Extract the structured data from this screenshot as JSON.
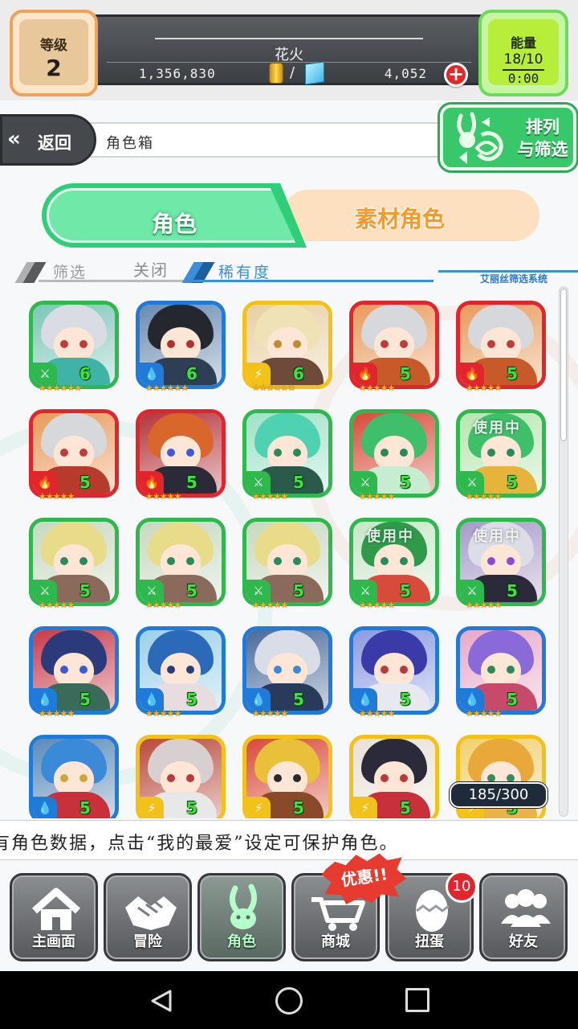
{
  "header": {
    "level_label": "等级",
    "level_value": "2",
    "player_name": "花火",
    "gold": "1,356,830",
    "gem_divider": "/",
    "gems": "4,052",
    "add_symbol": "+",
    "energy_label": "能量",
    "energy_value": "18/10",
    "energy_timer": "0:00"
  },
  "nav": {
    "back_chevron": "«",
    "back_label": "返回",
    "breadcrumb": "角色箱",
    "sort_label_line1": "排列",
    "sort_label_line2": "与筛选"
  },
  "tabs": [
    {
      "label": "角色",
      "active": true
    },
    {
      "label": "素材角色",
      "active": false
    }
  ],
  "filter": {
    "filter_label": "筛选",
    "filter_state": "关闭",
    "sort_by": "稀有度",
    "system_label": "艾丽丝筛选系统"
  },
  "colors": {
    "wood": "#2fb84e",
    "water": "#1f7ad8",
    "fire": "#e0262c",
    "light": "#f2c21a"
  },
  "cards": [
    {
      "element": "wood",
      "icon": "wood-element-icon",
      "glyph": "⚔",
      "rarity": "6",
      "stars": "★★★★★★",
      "in_use": "",
      "hair": "#d9dde3",
      "bg": "#7cc6b8",
      "body": "#3fb3a5",
      "eye": "#c23a3a"
    },
    {
      "element": "water",
      "icon": "water-element-icon",
      "glyph": "💧",
      "rarity": "6",
      "stars": "★★★★★★",
      "in_use": "",
      "hair": "#25272e",
      "bg": "#6a8ab0",
      "body": "#2e3f55",
      "eye": "#b23030"
    },
    {
      "element": "light",
      "icon": "light-element-icon",
      "glyph": "⚡",
      "rarity": "6",
      "stars": "★★★★★★",
      "in_use": "",
      "hair": "#efe2b6",
      "bg": "#e8cfa3",
      "body": "#6e4a3a",
      "eye": "#c28a2a"
    },
    {
      "element": "fire",
      "icon": "fire-element-icon",
      "glyph": "🔥",
      "rarity": "5",
      "stars": "★★★★★",
      "in_use": "",
      "hair": "#d6d8dc",
      "bg": "#e89a5a",
      "body": "#c85a2a",
      "eye": "#c23a3a"
    },
    {
      "element": "fire",
      "icon": "fire-element-icon",
      "glyph": "🔥",
      "rarity": "5",
      "stars": "★★★★★",
      "in_use": "",
      "hair": "#d6d8dc",
      "bg": "#e89a5a",
      "body": "#c85a2a",
      "eye": "#c23a3a"
    },
    {
      "element": "fire",
      "icon": "fire-element-icon",
      "glyph": "🔥",
      "rarity": "5",
      "stars": "★★★★★",
      "in_use": "",
      "hair": "#d6d8dc",
      "bg": "#e89a5a",
      "body": "#b83a2a",
      "eye": "#c23a3a"
    },
    {
      "element": "fire",
      "icon": "fire-element-icon",
      "glyph": "🔥",
      "rarity": "5",
      "stars": "★★★★★",
      "in_use": "",
      "hair": "#d9662a",
      "bg": "#b4343a",
      "body": "#2a2a38",
      "eye": "#3a5ad8"
    },
    {
      "element": "wood",
      "icon": "wood-element-icon",
      "glyph": "⚔",
      "rarity": "5",
      "stars": "★★★★★",
      "in_use": "",
      "hair": "#4fd2b2",
      "bg": "#9fe0c8",
      "body": "#2a5a4a",
      "eye": "#2a8a5a"
    },
    {
      "element": "wood",
      "icon": "wood-element-icon",
      "glyph": "⚔",
      "rarity": "5",
      "stars": "★★★★★",
      "in_use": "",
      "hair": "#3fbf6a",
      "bg": "#d84a3a",
      "body": "#c8ecd2",
      "eye": "#2a8a5a"
    },
    {
      "element": "wood",
      "icon": "wood-element-icon",
      "glyph": "⚔",
      "rarity": "5",
      "stars": "★★★★★",
      "in_use": "使用中",
      "hair": "#3fbf6a",
      "bg": "#b6e6b0",
      "body": "#e6b43a",
      "eye": "#2a8a5a"
    },
    {
      "element": "wood",
      "icon": "wood-element-icon",
      "glyph": "⚔",
      "rarity": "5",
      "stars": "★★★★★",
      "in_use": "",
      "hair": "#e8dc8a",
      "bg": "#c8d8c0",
      "body": "#8a6a5a",
      "eye": "#2a8a5a"
    },
    {
      "element": "wood",
      "icon": "wood-element-icon",
      "glyph": "⚔",
      "rarity": "5",
      "stars": "★★★★★",
      "in_use": "",
      "hair": "#e8dc8a",
      "bg": "#c8d8c0",
      "body": "#8a6a5a",
      "eye": "#2a8a5a"
    },
    {
      "element": "wood",
      "icon": "wood-element-icon",
      "glyph": "⚔",
      "rarity": "5",
      "stars": "★★★★★",
      "in_use": "",
      "hair": "#e8dc8a",
      "bg": "#c8d8c0",
      "body": "#8a6a5a",
      "eye": "#2a8a5a"
    },
    {
      "element": "wood",
      "icon": "wood-element-icon",
      "glyph": "⚔",
      "rarity": "5",
      "stars": "★★★★★",
      "in_use": "使用中",
      "hair": "#2f9a4a",
      "bg": "#c8e6c8",
      "body": "#d84a3a",
      "eye": "#2a8a5a"
    },
    {
      "element": "wood",
      "icon": "wood-element-icon",
      "glyph": "⚔",
      "rarity": "5",
      "stars": "★★★★★",
      "in_use": "使用中",
      "hair": "#dcdde6",
      "bg": "#a89ac8",
      "body": "#2a2a3a",
      "eye": "#8a4ad8"
    },
    {
      "element": "water",
      "icon": "water-element-icon",
      "glyph": "💧",
      "rarity": "5",
      "stars": "★★★★★",
      "in_use": "",
      "hair": "#2a3a7a",
      "bg": "#c83a4a",
      "body": "#3a6a5a",
      "eye": "#3a5ad8"
    },
    {
      "element": "water",
      "icon": "water-element-icon",
      "glyph": "💧",
      "rarity": "5",
      "stars": "★★★★★",
      "in_use": "",
      "hair": "#2a6ab8",
      "bg": "#9ad0e8",
      "body": "#e8dce0",
      "eye": "#2a3a7a"
    },
    {
      "element": "water",
      "icon": "water-element-icon",
      "glyph": "💧",
      "rarity": "5",
      "stars": "★★★★★",
      "in_use": "",
      "hair": "#d8dde8",
      "bg": "#4a6a9a",
      "body": "#2a3a5a",
      "eye": "#3a8ad8"
    },
    {
      "element": "water",
      "icon": "water-element-icon",
      "glyph": "💧",
      "rarity": "5",
      "stars": "★★★★★",
      "in_use": "",
      "hair": "#3a3aa8",
      "bg": "#8a9ae0",
      "body": "#e8e8f0",
      "eye": "#b83a3a"
    },
    {
      "element": "water",
      "icon": "water-element-icon",
      "glyph": "💧",
      "rarity": "5",
      "stars": "★★★★★",
      "in_use": "",
      "hair": "#8a6ad8",
      "bg": "#e8a8c8",
      "body": "#c84a6a",
      "eye": "#2a8a5a"
    },
    {
      "element": "water",
      "icon": "water-element-icon",
      "glyph": "💧",
      "rarity": "5",
      "stars": "★★★★★",
      "in_use": "",
      "hair": "#3a8ad8",
      "bg": "#5a8ab8",
      "body": "#c8303a",
      "eye": "#c8a83a"
    },
    {
      "element": "light",
      "icon": "light-element-icon",
      "glyph": "⚡",
      "rarity": "5",
      "stars": "★★★★★",
      "in_use": "",
      "hair": "#d8d0d0",
      "bg": "#b84a3a",
      "body": "#e8e8e8",
      "eye": "#b83a3a"
    },
    {
      "element": "light",
      "icon": "light-element-icon",
      "glyph": "⚡",
      "rarity": "5",
      "stars": "★★★★★",
      "in_use": "",
      "hair": "#e8c03a",
      "bg": "#d84a3a",
      "body": "#8a4a2a",
      "eye": "#2a2a2a"
    },
    {
      "element": "light",
      "icon": "light-element-icon",
      "glyph": "⚡",
      "rarity": "5",
      "stars": "★★★★★",
      "in_use": "",
      "hair": "#2a2a3a",
      "bg": "#e8e0d8",
      "body": "#c8303a",
      "eye": "#b83a3a"
    },
    {
      "element": "light",
      "icon": "light-element-icon",
      "glyph": "⚡",
      "rarity": "5",
      "stars": "★★★★★",
      "in_use": "",
      "hair": "#e8a83a",
      "bg": "#f0d070",
      "body": "#e8b44a",
      "eye": "#3a8a5a"
    }
  ],
  "box_count": "185/300",
  "ticker": "有角色数据，点击“我的最爱”设定可保护角色。",
  "menu": [
    {
      "label": "主画面",
      "icon": "home-icon",
      "active": false
    },
    {
      "label": "冒险",
      "icon": "handshake-icon",
      "active": false
    },
    {
      "label": "角色",
      "icon": "rabbit-icon",
      "active": true
    },
    {
      "label": "商城",
      "icon": "cart-icon",
      "active": false
    },
    {
      "label": "扭蛋",
      "icon": "egg-icon",
      "active": false
    },
    {
      "label": "好友",
      "icon": "friends-icon",
      "active": false
    }
  ],
  "promo_label": "优惠!!",
  "gacha_badge": "10"
}
